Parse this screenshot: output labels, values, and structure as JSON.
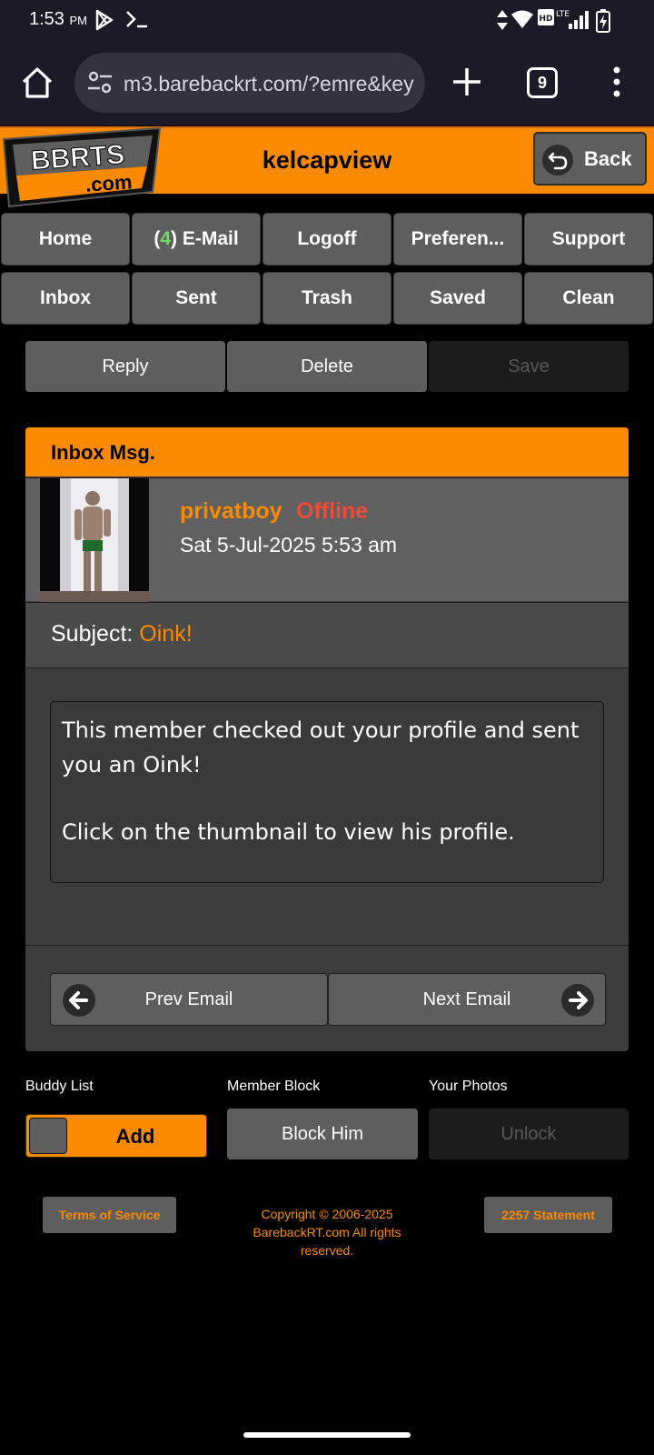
{
  "status_bar": {
    "time": "1:53",
    "ampm": "PM",
    "icons": [
      "play-store-icon",
      "terminal-icon",
      "data-arrows-icon",
      "wifi-icon",
      "hd-icon",
      "lte-signal-icon",
      "battery-charging-icon"
    ]
  },
  "browser": {
    "url": "m3.barebackrt.com/?emre&key",
    "tab_count": "9"
  },
  "header": {
    "logo_top": "BBRTS",
    "logo_bottom": ".com",
    "title": "kelcapview",
    "back_label": "Back"
  },
  "nav": {
    "row1": [
      "Home",
      "E-Mail",
      "Logoff",
      "Preferen...",
      "Support"
    ],
    "email_count": "4",
    "row2": [
      "Inbox",
      "Sent",
      "Trash",
      "Saved",
      "Clean"
    ]
  },
  "actions": {
    "reply": "Reply",
    "delete": "Delete",
    "save": "Save"
  },
  "message": {
    "header": "Inbox Msg.",
    "sender": "privatboy",
    "status": "Offline",
    "date": "Sat 5-Jul-2025 5:53 am",
    "subject_label": "Subject:",
    "subject": "Oink!",
    "body_line1": "This member checked out your profile and sent you an Oink!",
    "body_line2": "Click on the thumbnail to view his profile.",
    "prev": "Prev Email",
    "next": "Next Email"
  },
  "bottom": {
    "buddy_label": "Buddy List",
    "buddy_button": "Add",
    "block_label": "Member Block",
    "block_button": "Block Him",
    "photos_label": "Your Photos",
    "photos_button": "Unlock"
  },
  "footer": {
    "terms": "Terms of Service",
    "copyright": "Copyright © 2006-2025 BarebackRT.com All rights reserved.",
    "statement": "2257 Statement"
  },
  "colors": {
    "accent": "#fb8a00",
    "offline": "#f04a3a",
    "count_green": "#67e05e",
    "button_gray": "#5e5e5e"
  }
}
